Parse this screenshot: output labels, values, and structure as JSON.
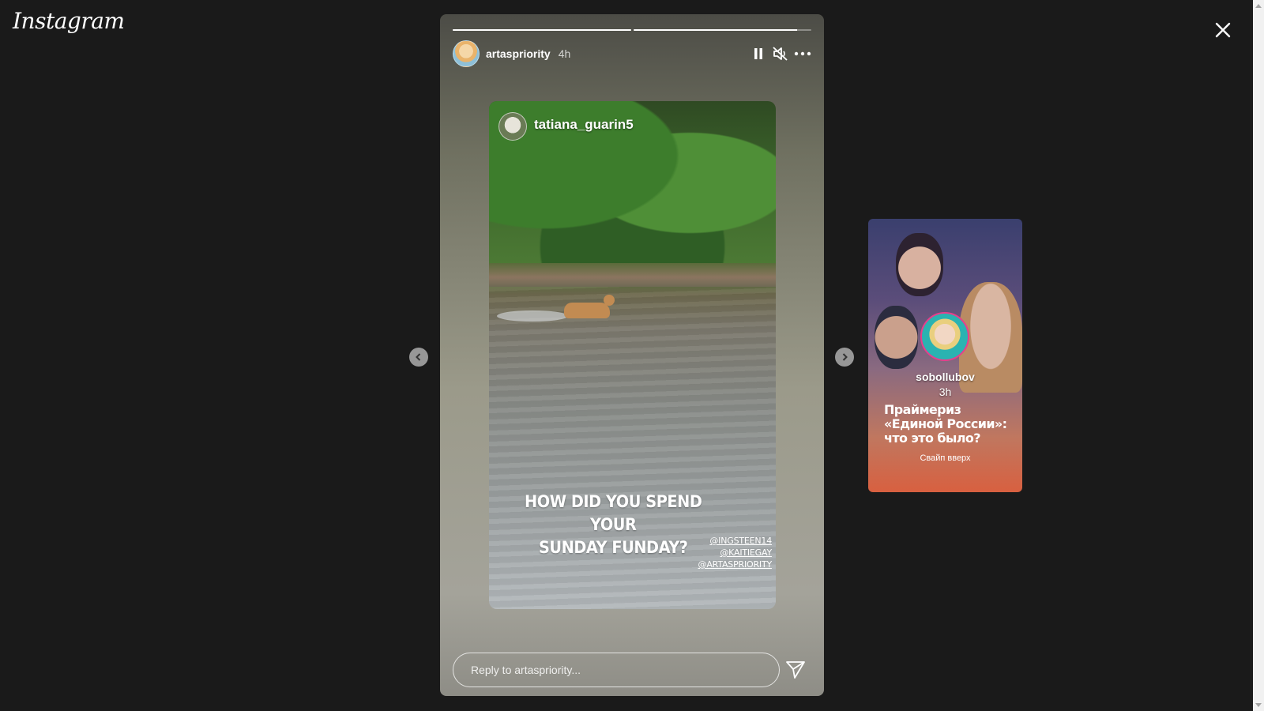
{
  "app": {
    "logo": "Instagram"
  },
  "story": {
    "progress": [
      1.0,
      0.92
    ],
    "user": {
      "username": "artaspriority",
      "time": "4h"
    },
    "controls": {
      "pause_icon": "pause-icon",
      "mute_icon": "muted-speaker-icon",
      "more_icon": "more-horizontal-icon"
    },
    "media": {
      "mention_username": "tatiana_guarin5",
      "text_lines": [
        "HOW DID YOU SPEND YOUR",
        "SUNDAY FUNDAY?"
      ],
      "tags": [
        "@INGSTEEN14",
        "@KAITIEGAY",
        "@ARTASPRIORITY"
      ]
    },
    "reply": {
      "placeholder": "Reply to artaspriority...",
      "send_icon": "send-icon"
    }
  },
  "nav": {
    "prev_icon": "chevron-left-icon",
    "next_icon": "chevron-right-icon",
    "close_icon": "close-icon"
  },
  "next_story": {
    "username": "sobollubov",
    "time": "3h",
    "title_lines": [
      "Праймериз",
      "«Единой России»:",
      "что это было?"
    ],
    "swipe_text": "Свайп вверх"
  }
}
